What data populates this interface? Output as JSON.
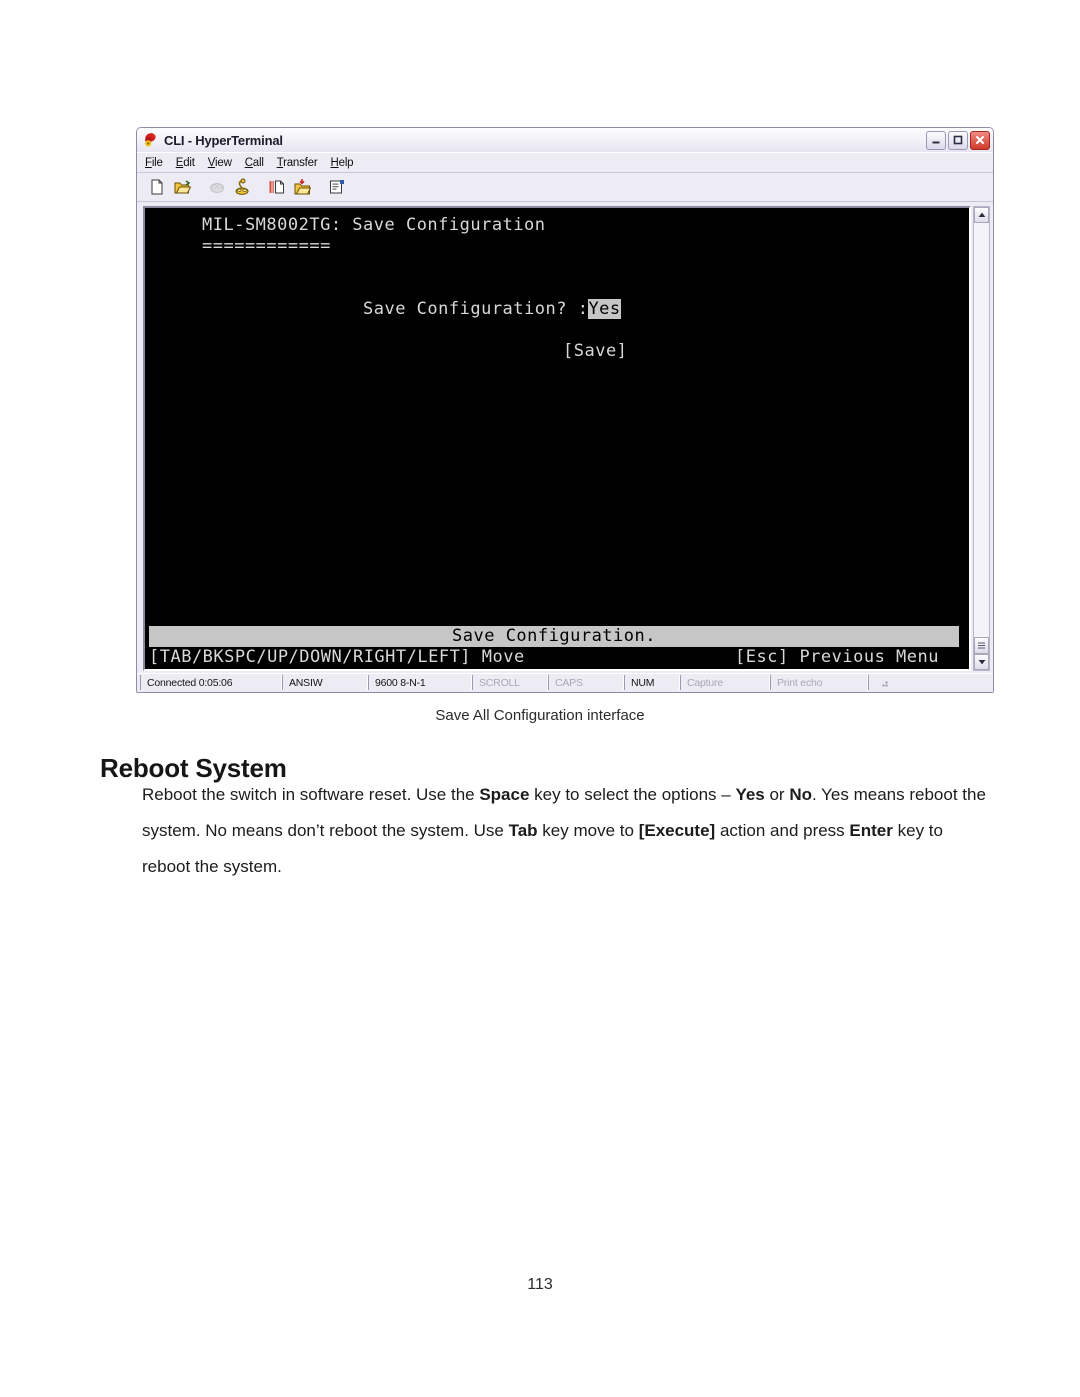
{
  "window": {
    "title": "CLI - HyperTerminal",
    "title_icon": "hyperterminal-icon",
    "controls": {
      "minimize": "minimize-button",
      "maximize": "maximize-button",
      "close": "close-button"
    },
    "menu": [
      {
        "label": "File",
        "accel": "F"
      },
      {
        "label": "Edit",
        "accel": "E"
      },
      {
        "label": "View",
        "accel": "V"
      },
      {
        "label": "Call",
        "accel": "C"
      },
      {
        "label": "Transfer",
        "accel": "T"
      },
      {
        "label": "Help",
        "accel": "H"
      }
    ],
    "toolbar": [
      {
        "name": "new-connection-icon",
        "enabled": true
      },
      {
        "name": "open-folder-icon",
        "enabled": true
      },
      {
        "name": "call-icon",
        "enabled": false
      },
      {
        "name": "disconnect-icon",
        "enabled": true
      },
      {
        "name": "send-file-icon",
        "enabled": true
      },
      {
        "name": "receive-file-icon",
        "enabled": true
      },
      {
        "name": "properties-icon",
        "enabled": true
      }
    ],
    "scrollbar": {
      "up_arrow": "scroll-up-arrow-icon",
      "down_arrow": "scroll-down-arrow-icon",
      "thumb_position": "bottom"
    },
    "statusbar": {
      "connected": "Connected 0:05:06",
      "emulation": "ANSIW",
      "line_settings": "9600 8-N-1",
      "scroll": "SCROLL",
      "caps": "CAPS",
      "num": "NUM",
      "capture": "Capture",
      "print_echo": "Print echo"
    }
  },
  "terminal": {
    "heading": "MIL-SM8002TG: Save Configuration",
    "heading_rule": "============",
    "prompt_label": "Save Configuration? :",
    "prompt_value": "Yes",
    "action_button": "[Save]",
    "status_line": "Save Configuration.",
    "key_help_left": "[TAB/BKSPC/UP/DOWN/RIGHT/LEFT] Move",
    "key_help_right": "[Esc] Previous Menu"
  },
  "document": {
    "figure_caption": "Save All Configuration interface",
    "section_title": "Reboot System",
    "paragraph": {
      "p1a": "Reboot the switch in software reset. Use the ",
      "p1b": "Space",
      "p1c": " key to select the options – ",
      "p1d": "Yes",
      "p1e": " or ",
      "p1f": "No",
      "p1g": ".",
      "p2a": "Yes means reboot the system. No means don’t reboot the system. Use ",
      "p2b": "Tab",
      "p2c": " key move to",
      "p3a": "[Execute]",
      "p3b": " action and press ",
      "p3c": "Enter",
      "p3d": " key to reboot the system."
    },
    "page_number": "113"
  },
  "colors": {
    "terminal_bg": "#000000",
    "terminal_fg": "#d8d8d8",
    "terminal_highlight_bg": "#c6c6c6",
    "window_chrome": "#edebf3",
    "close_button": "#cf3a2c"
  }
}
